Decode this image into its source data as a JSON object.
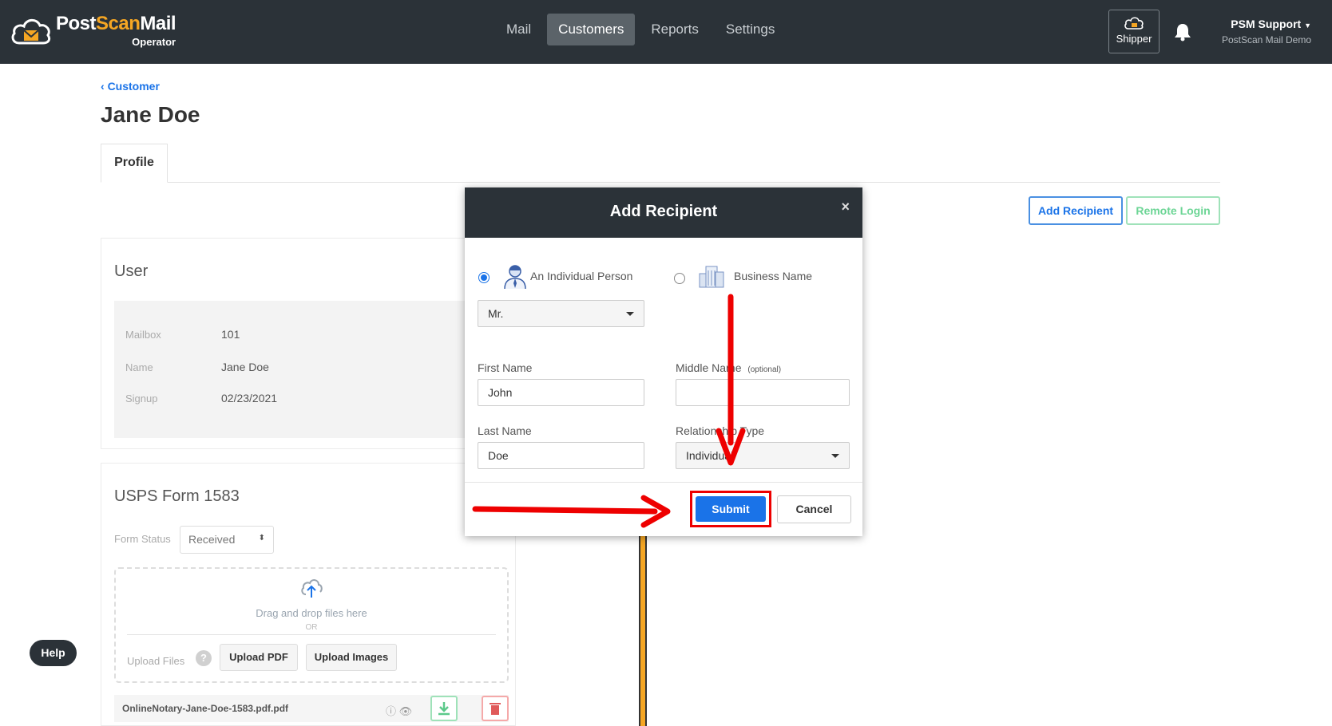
{
  "app": {
    "logo_brand_part1": "Post",
    "logo_brand_part2": "Scan",
    "logo_brand_part3": "Mail",
    "logo_subtitle": "Operator"
  },
  "nav": {
    "items": [
      {
        "label": "Mail",
        "active": false
      },
      {
        "label": "Customers",
        "active": true
      },
      {
        "label": "Reports",
        "active": false
      },
      {
        "label": "Settings",
        "active": false
      }
    ],
    "shipper_label": "Shipper",
    "user_name": "PSM Support",
    "user_org": "PostScan Mail Demo"
  },
  "page": {
    "back_link": "Customer",
    "title": "Jane Doe",
    "tab_profile": "Profile",
    "add_recipient_button": "Add Recipient",
    "remote_login_button": "Remote Login"
  },
  "user_card": {
    "title": "User",
    "rows": [
      {
        "label": "Mailbox",
        "value": "101"
      },
      {
        "label": "Name",
        "value": "Jane Doe"
      },
      {
        "label": "Signup",
        "value": "02/23/2021"
      }
    ]
  },
  "usps_card": {
    "title": "USPS Form 1583",
    "form_status_label": "Form Status",
    "form_status_value": "Received",
    "dropzone_text": "Drag and drop files here",
    "dropzone_or": "OR",
    "upload_files_label": "Upload Files",
    "upload_pdf_button": "Upload PDF",
    "upload_images_button": "Upload Images",
    "file_name": "OnlineNotary-Jane-Doe-1583.pdf.pdf"
  },
  "help_button": "Help",
  "modal": {
    "title": "Add Recipient",
    "close_symbol": "×",
    "option_individual": "An Individual Person",
    "option_business": "Business Name",
    "selected_option": "individual",
    "salutation_value": "Mr.",
    "first_name_label": "First Name",
    "first_name_value": "John",
    "middle_name_label": "Middle Name",
    "middle_name_optional": "(optional)",
    "middle_name_value": "",
    "last_name_label": "Last Name",
    "last_name_value": "Doe",
    "relationship_label": "Relationship Type",
    "relationship_value": "Individual",
    "submit_button": "Submit",
    "cancel_button": "Cancel"
  },
  "colors": {
    "topbar": "#2b3238",
    "primary": "#1a73e8",
    "success": "#6cd595",
    "annotation": "#e00000",
    "brand_accent": "#f5a623"
  }
}
